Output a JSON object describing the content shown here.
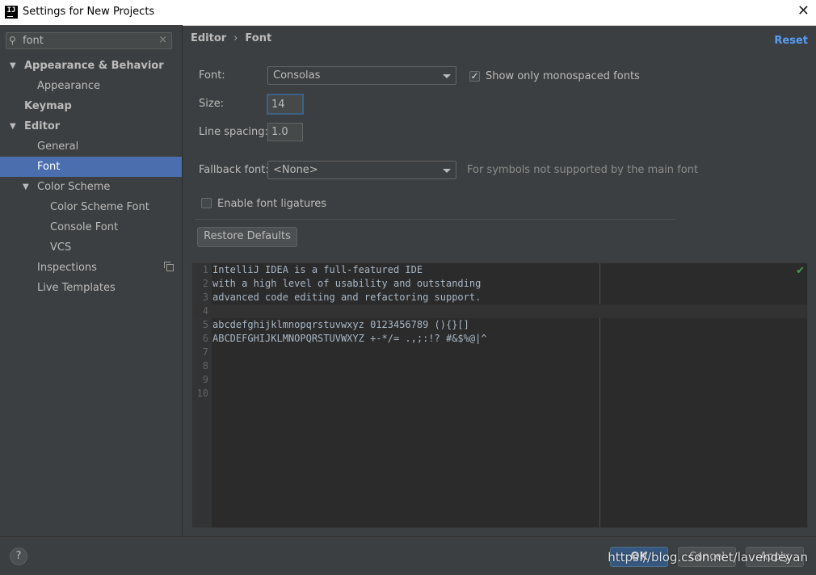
{
  "window": {
    "title": "Settings for New Projects",
    "icon": "IJ",
    "close_icon": "close-icon"
  },
  "search": {
    "value": "font"
  },
  "tree": {
    "appearance_behavior": "Appearance & Behavior",
    "appearance": "Appearance",
    "keymap": "Keymap",
    "editor": "Editor",
    "general": "General",
    "font": "Font",
    "color_scheme": "Color Scheme",
    "color_scheme_font": "Color Scheme Font",
    "console_font": "Console Font",
    "vcs": "VCS",
    "inspections": "Inspections",
    "live_templates": "Live Templates"
  },
  "breadcrumb": {
    "parent": "Editor",
    "separator": "›",
    "current": "Font"
  },
  "reset_label": "Reset",
  "form": {
    "font_label": "Font:",
    "font_value": "Consolas",
    "mono_checkbox_label": "Show only monospaced fonts",
    "mono_checked": true,
    "size_label": "Size:",
    "size_value": "14",
    "line_spacing_label": "Line spacing:",
    "line_spacing_value": "1.0",
    "fallback_label": "Fallback font:",
    "fallback_value": "<None>",
    "fallback_hint": "For symbols not supported by the main font",
    "ligatures_label": "Enable font ligatures",
    "ligatures_checked": false,
    "restore_defaults_label": "Restore Defaults"
  },
  "preview": {
    "lines": [
      {
        "num": "1",
        "text": "IntelliJ IDEA is a full-featured IDE"
      },
      {
        "num": "2",
        "text": "with a high level of usability and outstanding"
      },
      {
        "num": "3",
        "text": "advanced code editing and refactoring support."
      },
      {
        "num": "4",
        "text": ""
      },
      {
        "num": "5",
        "text": "abcdefghijklmnopqrstuvwxyz 0123456789 (){}[]"
      },
      {
        "num": "6",
        "text": "ABCDEFGHIJKLMNOPQRSTUVWXYZ +-*/= .,;:!? #&$%@|^"
      },
      {
        "num": "7",
        "text": ""
      },
      {
        "num": "8",
        "text": ""
      },
      {
        "num": "9",
        "text": ""
      },
      {
        "num": "10",
        "text": ""
      }
    ]
  },
  "footer": {
    "help_label": "?",
    "ok_label": "OK",
    "cancel_label": "Cancel",
    "apply_label": "Apply",
    "watermark": "https://blog.csdn.net/lavendeyan"
  }
}
